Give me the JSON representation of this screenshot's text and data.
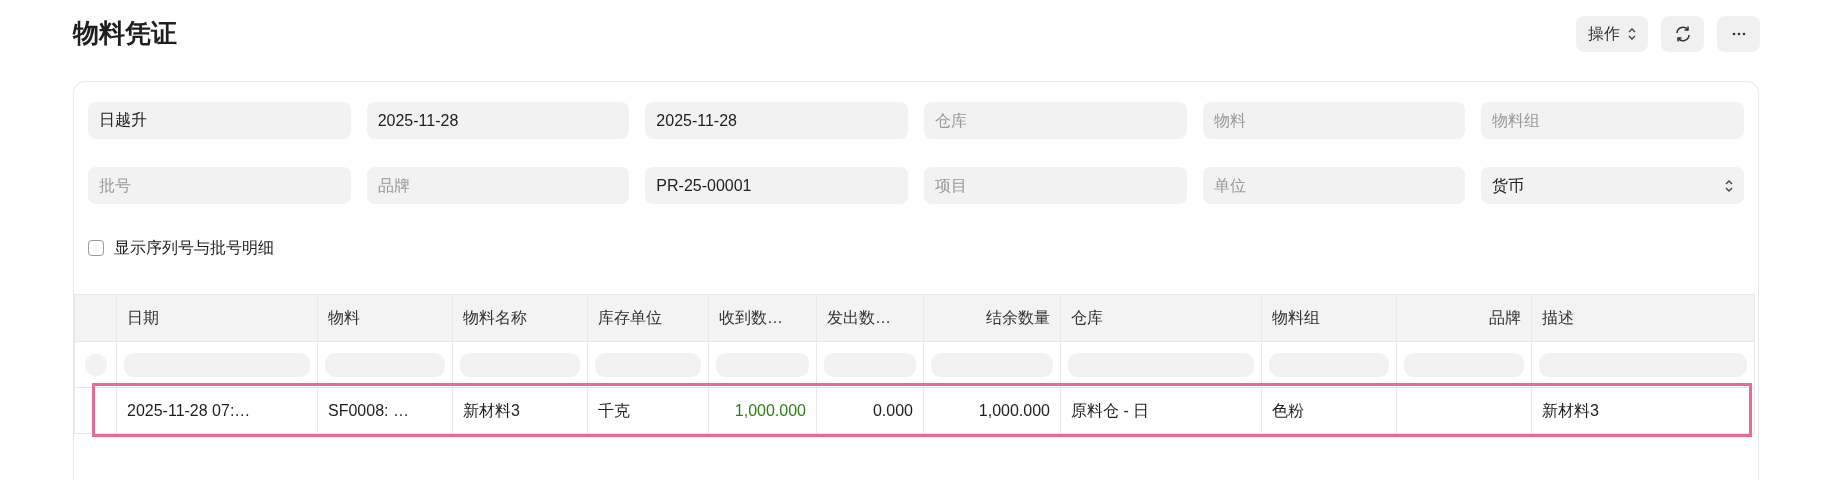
{
  "title": "物料凭证",
  "actions": [
    {
      "kind": "dropdown",
      "label": "操作"
    },
    {
      "kind": "refresh"
    },
    {
      "kind": "more"
    }
  ],
  "filters": [
    {
      "kind": "text",
      "value": "日越升"
    },
    {
      "kind": "text",
      "value": "2025-11-28"
    },
    {
      "kind": "text",
      "value": "2025-11-28"
    },
    {
      "kind": "text",
      "placeholder": "仓库"
    },
    {
      "kind": "text",
      "placeholder": "物料"
    },
    {
      "kind": "text",
      "placeholder": "物料组"
    },
    {
      "kind": "text",
      "placeholder": "批号"
    },
    {
      "kind": "text",
      "placeholder": "品牌"
    },
    {
      "kind": "text",
      "value": "PR-25-00001"
    },
    {
      "kind": "text",
      "placeholder": "项目"
    },
    {
      "kind": "text",
      "placeholder": "单位"
    },
    {
      "kind": "select",
      "value": "货币"
    }
  ],
  "checkbox": {
    "label": "显示序列号与批号明细",
    "checked": false
  },
  "table": {
    "columns": [
      {
        "label": "日期",
        "right_aligned": false
      },
      {
        "label": "物料",
        "right_aligned": false
      },
      {
        "label": "物料名称",
        "right_aligned": false
      },
      {
        "label": "库存单位",
        "right_aligned": false
      },
      {
        "label": "收到数…",
        "right_aligned": false
      },
      {
        "label": "发出数…",
        "right_aligned": false
      },
      {
        "label": "结余数量",
        "right_aligned": true
      },
      {
        "label": "仓库",
        "right_aligned": false
      },
      {
        "label": "物料组",
        "right_aligned": false
      },
      {
        "label": "品牌",
        "right_aligned": true
      },
      {
        "label": "描述",
        "right_aligned": false
      }
    ],
    "rows": [
      {
        "highlighted": true,
        "cells": [
          {
            "text": "2025-11-28 07:…",
            "right_aligned": false
          },
          {
            "text": "SF0008: …",
            "right_aligned": false
          },
          {
            "text": "新材料3",
            "right_aligned": false
          },
          {
            "text": "千克",
            "right_aligned": false
          },
          {
            "text": "1,000.000",
            "right_aligned": true,
            "color": "#2e7d14"
          },
          {
            "text": "0.000",
            "right_aligned": true
          },
          {
            "text": "1,000.000",
            "right_aligned": true
          },
          {
            "text": "原料仓 - 日",
            "right_aligned": false
          },
          {
            "text": "色粉",
            "right_aligned": false
          },
          {
            "text": ""
          },
          {
            "text": "新材料3",
            "right_aligned": false
          }
        ]
      }
    ]
  }
}
